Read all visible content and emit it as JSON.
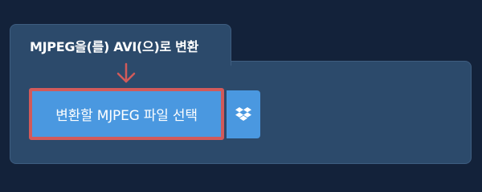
{
  "tab": {
    "title": "MJPEG을(를) AVI(으)로 변환"
  },
  "upload": {
    "choose_label": "변환할 MJPEG 파일 선택",
    "dropbox_icon": "dropbox-icon",
    "arrow_icon": "arrow-down-icon"
  },
  "colors": {
    "background": "#13223a",
    "panel": "#2c4a6b",
    "button": "#4a98e0",
    "highlight_border": "#d25a5a"
  }
}
